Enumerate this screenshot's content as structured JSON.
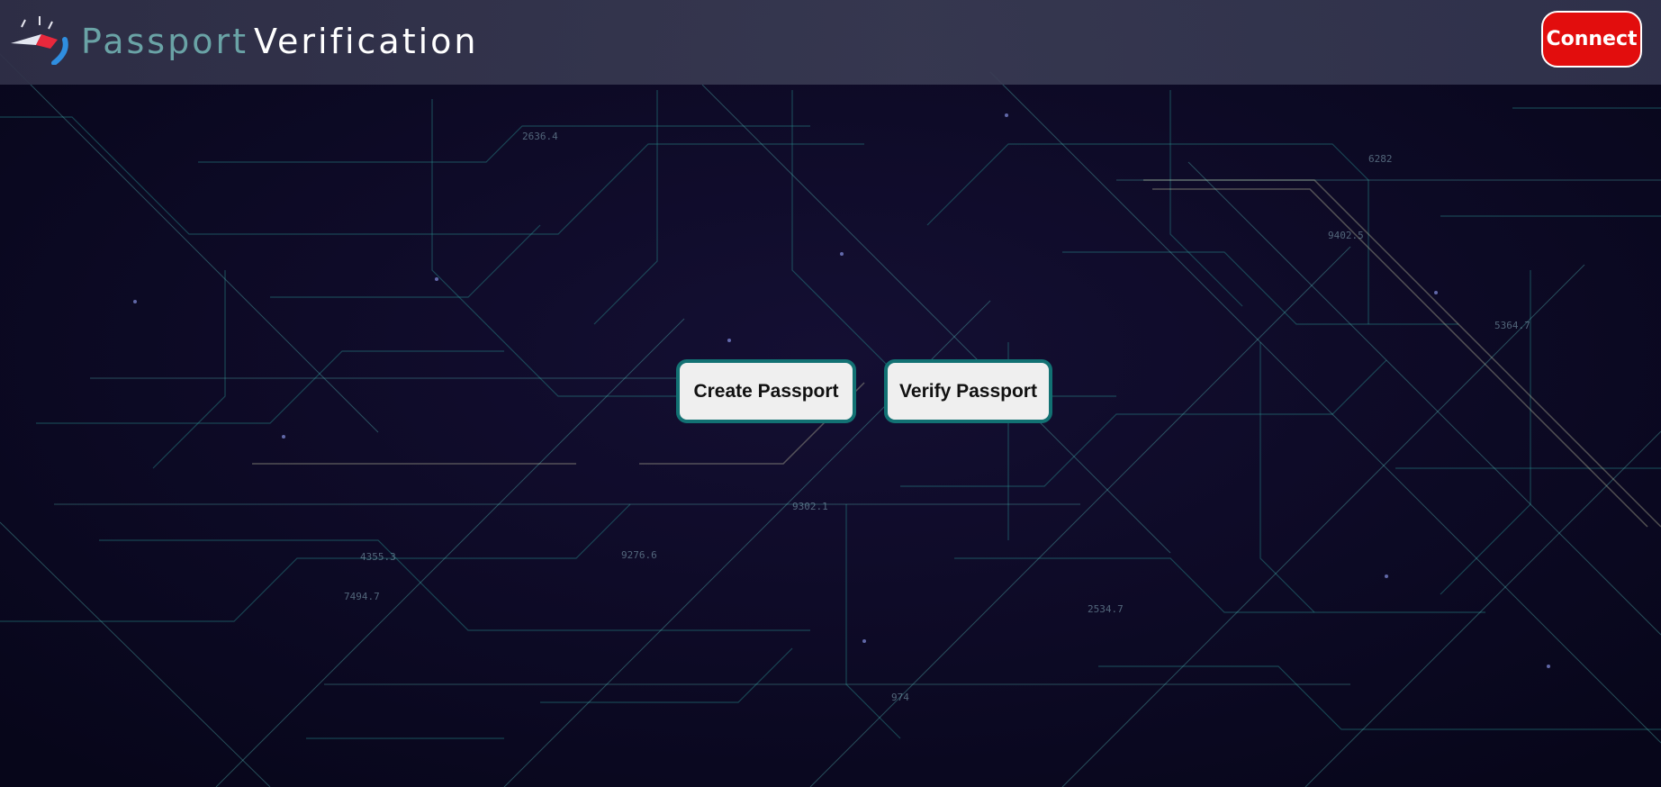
{
  "header": {
    "brand_part1": "Passport",
    "brand_part2": "Verification",
    "connect_label": "Connect"
  },
  "actions": {
    "create_label": "Create Passport",
    "verify_label": "Verify Passport"
  },
  "colors": {
    "connect_bg": "#e20d0d",
    "button_border": "#127173",
    "brand_accent": "#6aa3a6",
    "background": "#0c0a1e"
  },
  "icons": {
    "logo": "passport-logo-icon"
  }
}
